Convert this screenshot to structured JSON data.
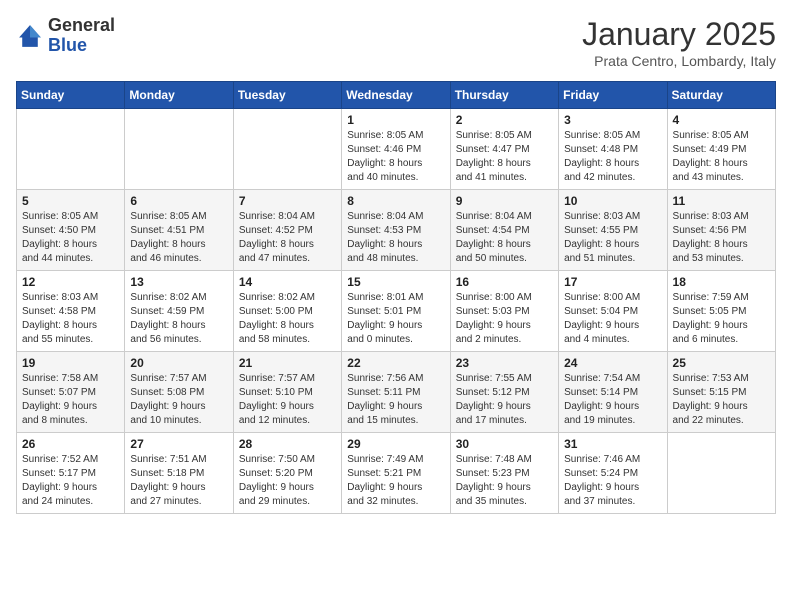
{
  "header": {
    "logo_general": "General",
    "logo_blue": "Blue",
    "month": "January 2025",
    "location": "Prata Centro, Lombardy, Italy"
  },
  "days_of_week": [
    "Sunday",
    "Monday",
    "Tuesday",
    "Wednesday",
    "Thursday",
    "Friday",
    "Saturday"
  ],
  "weeks": [
    [
      {
        "day": "",
        "info": ""
      },
      {
        "day": "",
        "info": ""
      },
      {
        "day": "",
        "info": ""
      },
      {
        "day": "1",
        "info": "Sunrise: 8:05 AM\nSunset: 4:46 PM\nDaylight: 8 hours\nand 40 minutes."
      },
      {
        "day": "2",
        "info": "Sunrise: 8:05 AM\nSunset: 4:47 PM\nDaylight: 8 hours\nand 41 minutes."
      },
      {
        "day": "3",
        "info": "Sunrise: 8:05 AM\nSunset: 4:48 PM\nDaylight: 8 hours\nand 42 minutes."
      },
      {
        "day": "4",
        "info": "Sunrise: 8:05 AM\nSunset: 4:49 PM\nDaylight: 8 hours\nand 43 minutes."
      }
    ],
    [
      {
        "day": "5",
        "info": "Sunrise: 8:05 AM\nSunset: 4:50 PM\nDaylight: 8 hours\nand 44 minutes."
      },
      {
        "day": "6",
        "info": "Sunrise: 8:05 AM\nSunset: 4:51 PM\nDaylight: 8 hours\nand 46 minutes."
      },
      {
        "day": "7",
        "info": "Sunrise: 8:04 AM\nSunset: 4:52 PM\nDaylight: 8 hours\nand 47 minutes."
      },
      {
        "day": "8",
        "info": "Sunrise: 8:04 AM\nSunset: 4:53 PM\nDaylight: 8 hours\nand 48 minutes."
      },
      {
        "day": "9",
        "info": "Sunrise: 8:04 AM\nSunset: 4:54 PM\nDaylight: 8 hours\nand 50 minutes."
      },
      {
        "day": "10",
        "info": "Sunrise: 8:03 AM\nSunset: 4:55 PM\nDaylight: 8 hours\nand 51 minutes."
      },
      {
        "day": "11",
        "info": "Sunrise: 8:03 AM\nSunset: 4:56 PM\nDaylight: 8 hours\nand 53 minutes."
      }
    ],
    [
      {
        "day": "12",
        "info": "Sunrise: 8:03 AM\nSunset: 4:58 PM\nDaylight: 8 hours\nand 55 minutes."
      },
      {
        "day": "13",
        "info": "Sunrise: 8:02 AM\nSunset: 4:59 PM\nDaylight: 8 hours\nand 56 minutes."
      },
      {
        "day": "14",
        "info": "Sunrise: 8:02 AM\nSunset: 5:00 PM\nDaylight: 8 hours\nand 58 minutes."
      },
      {
        "day": "15",
        "info": "Sunrise: 8:01 AM\nSunset: 5:01 PM\nDaylight: 9 hours\nand 0 minutes."
      },
      {
        "day": "16",
        "info": "Sunrise: 8:00 AM\nSunset: 5:03 PM\nDaylight: 9 hours\nand 2 minutes."
      },
      {
        "day": "17",
        "info": "Sunrise: 8:00 AM\nSunset: 5:04 PM\nDaylight: 9 hours\nand 4 minutes."
      },
      {
        "day": "18",
        "info": "Sunrise: 7:59 AM\nSunset: 5:05 PM\nDaylight: 9 hours\nand 6 minutes."
      }
    ],
    [
      {
        "day": "19",
        "info": "Sunrise: 7:58 AM\nSunset: 5:07 PM\nDaylight: 9 hours\nand 8 minutes."
      },
      {
        "day": "20",
        "info": "Sunrise: 7:57 AM\nSunset: 5:08 PM\nDaylight: 9 hours\nand 10 minutes."
      },
      {
        "day": "21",
        "info": "Sunrise: 7:57 AM\nSunset: 5:10 PM\nDaylight: 9 hours\nand 12 minutes."
      },
      {
        "day": "22",
        "info": "Sunrise: 7:56 AM\nSunset: 5:11 PM\nDaylight: 9 hours\nand 15 minutes."
      },
      {
        "day": "23",
        "info": "Sunrise: 7:55 AM\nSunset: 5:12 PM\nDaylight: 9 hours\nand 17 minutes."
      },
      {
        "day": "24",
        "info": "Sunrise: 7:54 AM\nSunset: 5:14 PM\nDaylight: 9 hours\nand 19 minutes."
      },
      {
        "day": "25",
        "info": "Sunrise: 7:53 AM\nSunset: 5:15 PM\nDaylight: 9 hours\nand 22 minutes."
      }
    ],
    [
      {
        "day": "26",
        "info": "Sunrise: 7:52 AM\nSunset: 5:17 PM\nDaylight: 9 hours\nand 24 minutes."
      },
      {
        "day": "27",
        "info": "Sunrise: 7:51 AM\nSunset: 5:18 PM\nDaylight: 9 hours\nand 27 minutes."
      },
      {
        "day": "28",
        "info": "Sunrise: 7:50 AM\nSunset: 5:20 PM\nDaylight: 9 hours\nand 29 minutes."
      },
      {
        "day": "29",
        "info": "Sunrise: 7:49 AM\nSunset: 5:21 PM\nDaylight: 9 hours\nand 32 minutes."
      },
      {
        "day": "30",
        "info": "Sunrise: 7:48 AM\nSunset: 5:23 PM\nDaylight: 9 hours\nand 35 minutes."
      },
      {
        "day": "31",
        "info": "Sunrise: 7:46 AM\nSunset: 5:24 PM\nDaylight: 9 hours\nand 37 minutes."
      },
      {
        "day": "",
        "info": ""
      }
    ]
  ]
}
